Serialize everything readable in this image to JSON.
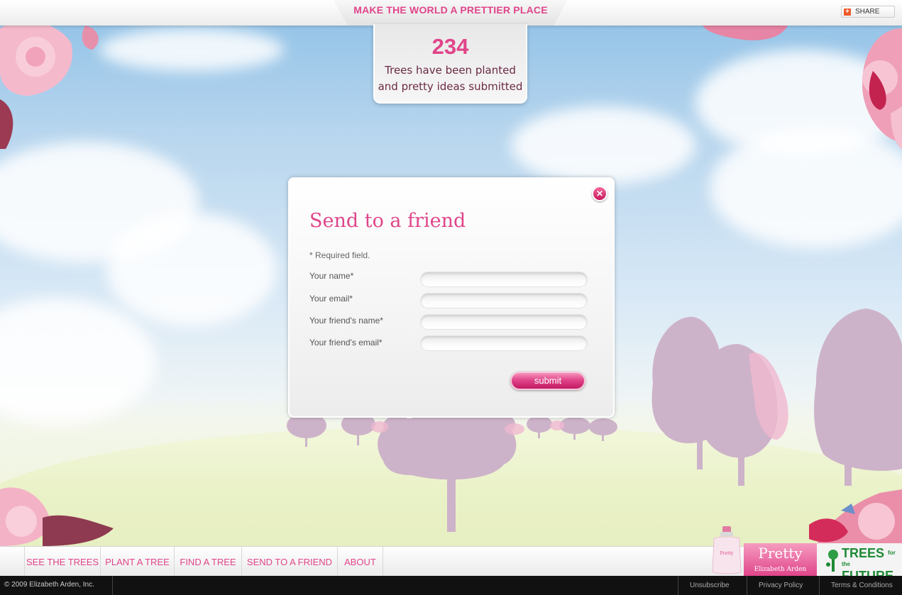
{
  "header": {
    "title": "MAKE THE WORLD A PRETTIER PLACE",
    "share_label": "SHARE",
    "share_icon": "plus-icon"
  },
  "counter": {
    "number": "234",
    "line1": "Trees have been planted",
    "line2": "and pretty ideas submitted"
  },
  "modal": {
    "title": "Send to a friend",
    "required_note": "* Required field.",
    "close_icon": "close-icon",
    "fields": [
      {
        "label": "Your name*",
        "value": ""
      },
      {
        "label": "Your email*",
        "value": ""
      },
      {
        "label": "Your friend's name*",
        "value": ""
      },
      {
        "label": "Your friend's email*",
        "value": ""
      }
    ],
    "submit_label": "submit"
  },
  "nav": {
    "items": [
      "SEE THE TREES",
      "PLANT A TREE",
      "FIND A TREE",
      "SEND TO A FRIEND",
      "ABOUT"
    ]
  },
  "brand": {
    "product": "Pretty",
    "maker": "Elizabeth Arden",
    "bottle_label": "Pretty",
    "partner_main": "TREES",
    "partner_small": "for the",
    "partner_bottom": "FUTURE"
  },
  "footer": {
    "copyright": "© 2009 Elizabeth Arden, Inc.",
    "links": [
      "Unsubscribe",
      "Privacy Policy",
      "Terms & Conditions"
    ]
  },
  "colors": {
    "accent_pink": "#e0458a",
    "dark_maroon": "#6b2a45",
    "tree_mauve": "#c9afc6",
    "partner_green": "#1f8a35"
  }
}
